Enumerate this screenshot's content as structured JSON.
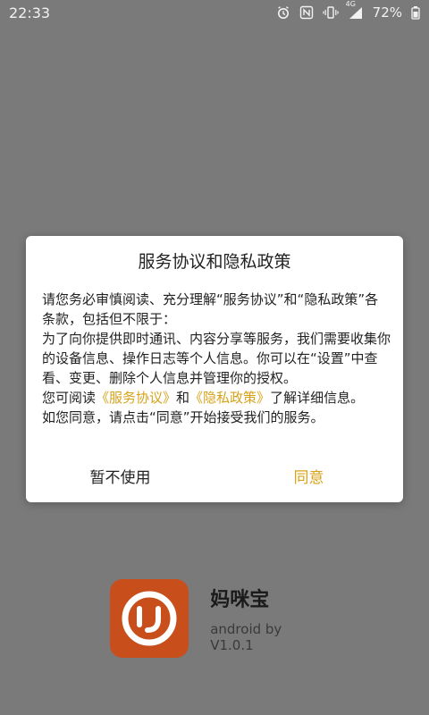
{
  "status_bar": {
    "time": "22:33",
    "network": "4G",
    "battery": "72%"
  },
  "dialog": {
    "title": "服务协议和隐私政策",
    "paragraph_1": "请您务必审慎阅读、充分理解“服务协议”和“隐私政策”各条款，包括但不限于：",
    "paragraph_2": "为了向你提供即时通讯、内容分享等服务，我们需要收集你的设备信息、操作日志等个人信息。你可以在“设置”中查看、变更、删除个人信息并管理你的授权。",
    "paragraph_3_prefix": "您可阅读",
    "link_service": "《服务协议》",
    "paragraph_3_middle": "和",
    "link_privacy": "《隐私政策》",
    "paragraph_3_suffix": "了解详细信息。",
    "paragraph_4": "如您同意，请点击“同意”开始接受我们的服务。",
    "cancel_label": "暂不使用",
    "accept_label": "同意"
  },
  "app": {
    "name": "妈咪宝",
    "version": "android by V1.0.1"
  },
  "colors": {
    "overlay_bg": "#7a7a7a",
    "accent": "#d7a21a",
    "app_icon_bg": "#c84f1c"
  }
}
